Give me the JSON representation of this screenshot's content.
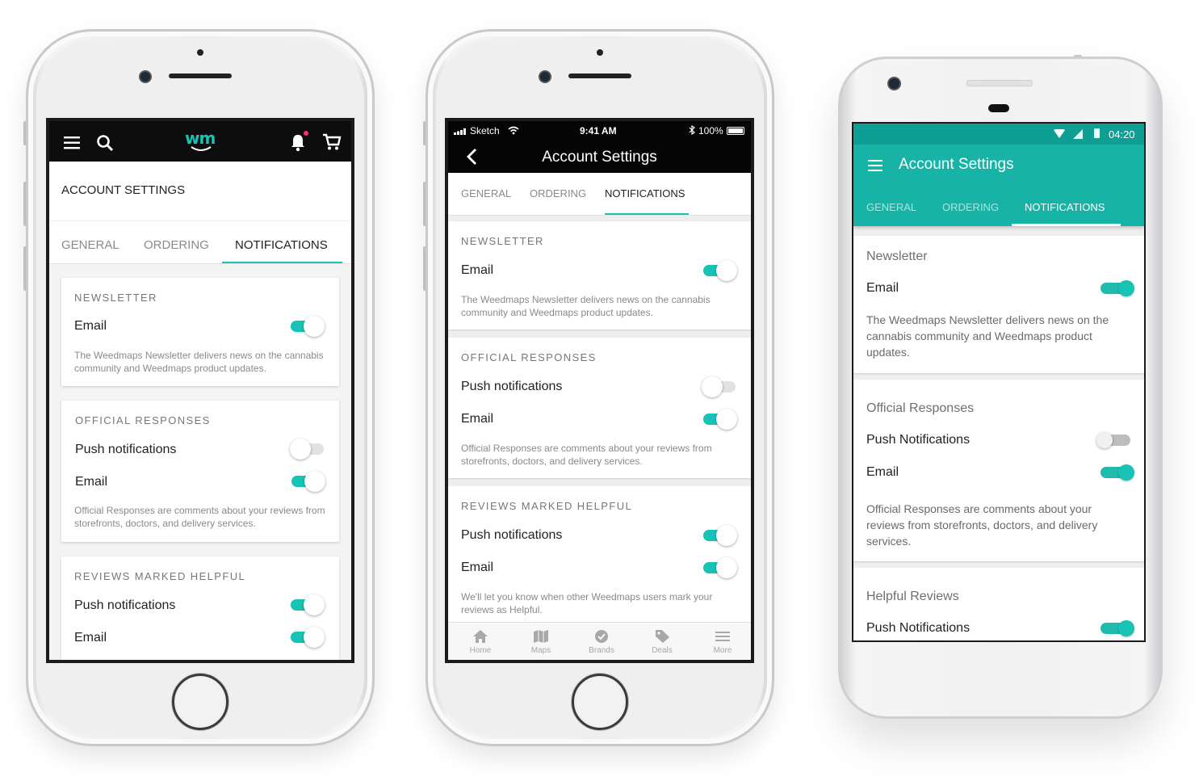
{
  "phone1": {
    "logo": "wm",
    "page_title": "ACCOUNT SETTINGS",
    "tabs": [
      "GENERAL",
      "ORDERING",
      "NOTIFICATIONS"
    ],
    "newsletter": {
      "title": "NEWSLETTER",
      "email_label": "Email",
      "email_on": true,
      "desc": "The Weedmaps Newsletter delivers news on the cannabis community and Weedmaps product updates."
    },
    "official": {
      "title": "OFFICIAL RESPONSES",
      "push_label": "Push notifications",
      "push_on": false,
      "email_label": "Email",
      "email_on": true,
      "desc": "Official Responses are comments about your reviews from storefronts, doctors, and delivery services."
    },
    "helpful": {
      "title": "REVIEWS MARKED HELPFUL",
      "push_label": "Push notifications",
      "push_on": true,
      "email_label": "Email",
      "email_on": true
    }
  },
  "phone2": {
    "status": {
      "carrier": "Sketch",
      "time": "9:41 AM",
      "battery": "100%"
    },
    "title": "Account Settings",
    "tabs": [
      "GENERAL",
      "ORDERING",
      "NOTIFICATIONS"
    ],
    "newsletter": {
      "title": "NEWSLETTER",
      "email_label": "Email",
      "email_on": true,
      "desc": "The Weedmaps Newsletter delivers news on the cannabis community and Weedmaps product updates."
    },
    "official": {
      "title": "OFFICIAL RESPONSES",
      "push_label": "Push notifications",
      "push_on": false,
      "email_label": "Email",
      "email_on": true,
      "desc": "Official Responses are comments about your reviews from storefronts, doctors, and delivery services."
    },
    "helpful": {
      "title": "REVIEWS MARKED HELPFUL",
      "push_label": "Push notifications",
      "push_on": true,
      "email_label": "Email",
      "email_on": true,
      "desc": "We'll let you know when other Weedmaps users mark your reviews as Helpful."
    },
    "bottom_nav": [
      "Home",
      "Maps",
      "Brands",
      "Deals",
      "More"
    ]
  },
  "phone3": {
    "status": {
      "time": "04:20"
    },
    "title": "Account Settings",
    "tabs": [
      "GENERAL",
      "ORDERING",
      "NOTIFICATIONS"
    ],
    "newsletter": {
      "title": "Newsletter",
      "email_label": "Email",
      "email_on": true,
      "desc": "The Weedmaps Newsletter delivers news on the cannabis community and Weedmaps product updates."
    },
    "official": {
      "title": "Official Responses",
      "push_label": "Push Notifications",
      "push_on": false,
      "email_label": "Email",
      "email_on": true,
      "desc": "Official Responses are comments about your reviews from storefronts, doctors, and delivery services."
    },
    "helpful": {
      "title": "Helpful Reviews",
      "push_label": "Push Notifications",
      "push_on": true
    }
  },
  "colors": {
    "accent": "#16c3b4",
    "android_bar": "#10ada3",
    "text": "#222222",
    "muted": "#8a8a8a",
    "notification_dot": "#ff2d6f"
  }
}
